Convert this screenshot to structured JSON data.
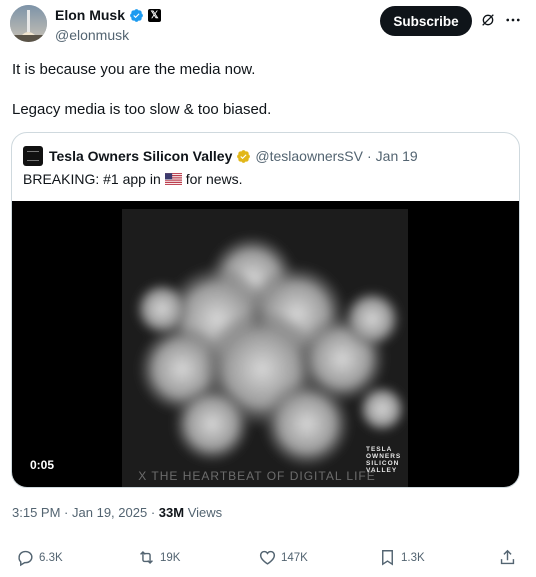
{
  "author": {
    "display_name": "Elon Musk",
    "handle": "@elonmusk",
    "verified_icon": "verified-blue-check-icon",
    "affiliate_icon": "x-logo-icon"
  },
  "header_actions": {
    "subscribe_label": "Subscribe",
    "grok_icon": "grok-icon",
    "more_icon": "more-dots-icon"
  },
  "tweet": {
    "lines": [
      "It is because you are the media now.",
      "Legacy media is too slow & too biased."
    ]
  },
  "quote": {
    "display_name": "Tesla Owners Silicon Valley",
    "handle": "@teslaownersSV",
    "separator": "·",
    "date": "Jan 19",
    "text_before_flag": "BREAKING: #1 app in",
    "flag_icon": "us-flag-icon",
    "text_after_flag": "for news.",
    "video": {
      "duration": "0:05",
      "watermark": "X THE HEARTBEAT OF DIGITAL LIFE",
      "corner_logo_lines": [
        "TESLA",
        "OWNERS",
        "SILICON",
        "VALLEY"
      ]
    }
  },
  "meta": {
    "time": "3:15 PM",
    "separator": "·",
    "date": "Jan 19, 2025",
    "views_count": "33M",
    "views_label": "Views"
  },
  "actions": {
    "replies": "6.3K",
    "reposts": "19K",
    "likes": "147K",
    "bookmarks": "1.3K"
  },
  "colors": {
    "text_primary": "#0f1419",
    "text_secondary": "#536471",
    "border": "#cfd9de",
    "verified_blue": "#1d9bf0",
    "verified_gold": "#e2b719"
  }
}
